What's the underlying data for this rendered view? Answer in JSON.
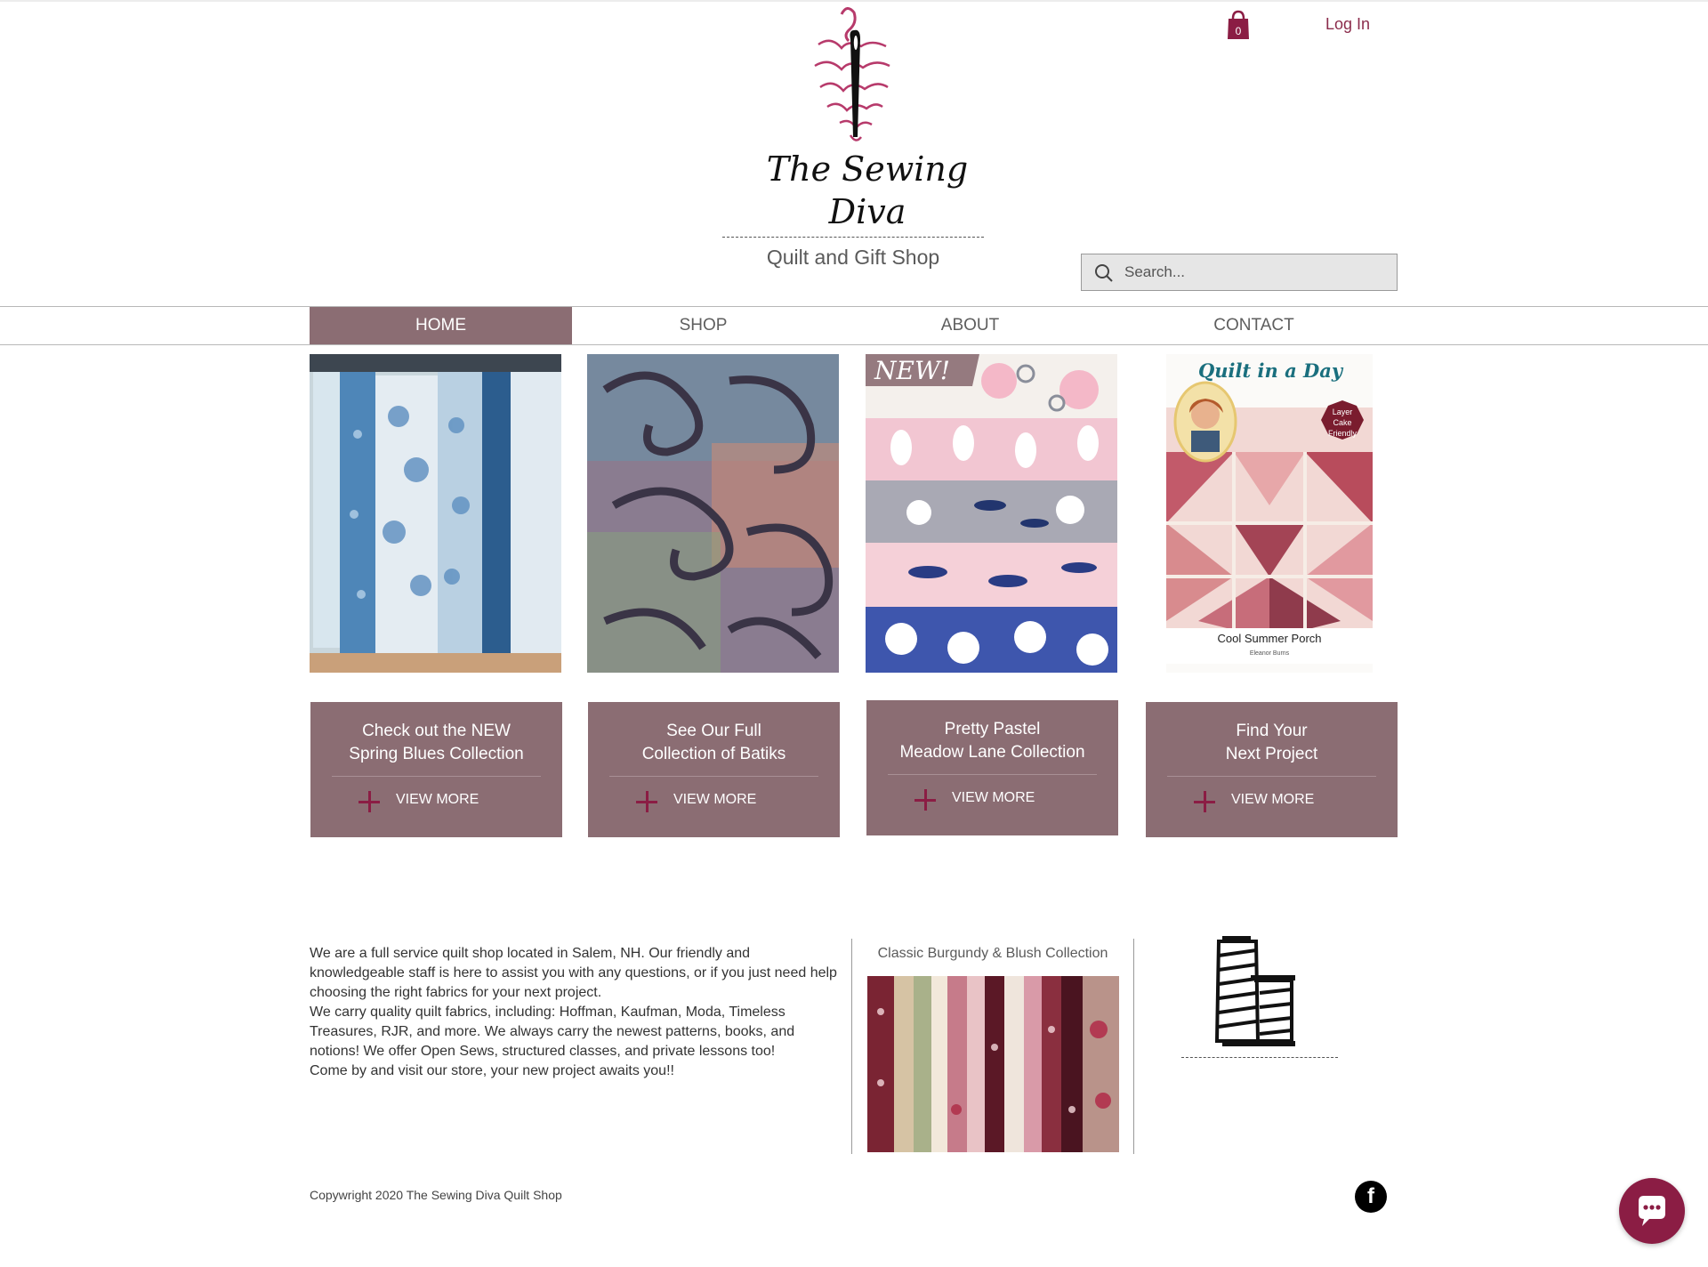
{
  "header": {
    "logo_line1": "The Sewing",
    "logo_line2": "Diva",
    "tagline": "Quilt and Gift Shop",
    "cart_count": "0",
    "login_label": "Log In"
  },
  "search": {
    "placeholder": "Search..."
  },
  "nav": {
    "items": [
      {
        "label": "HOME",
        "active": true
      },
      {
        "label": "SHOP",
        "active": false
      },
      {
        "label": "ABOUT",
        "active": false
      },
      {
        "label": "CONTACT",
        "active": false
      }
    ]
  },
  "products": [
    {
      "title_line1": "Check out the NEW",
      "title_line2": "Spring Blues Collection",
      "cta": "VIEW MORE"
    },
    {
      "title_line1": "See Our Full",
      "title_line2": "Collection of Batiks",
      "cta": "VIEW MORE"
    },
    {
      "title_line1": "Pretty Pastel",
      "title_line2": "Meadow Lane Collection",
      "cta": "VIEW MORE",
      "badge": "NEW!"
    },
    {
      "title_line1": "Find Your",
      "title_line2": "Next Project",
      "cta": "VIEW MORE",
      "book_title": "Quilt in a Day",
      "book_badge": "Layer Cake Friendly",
      "book_subtitle": "Cool Summer Porch",
      "book_author": "Eleanor Burns"
    }
  ],
  "about": {
    "paragraph1": "We are a full service quilt shop located in Salem, NH. Our friendly and knowledgeable staff is here to assist you with any questions, or if you just need help choosing the right fabrics for your next project.",
    "paragraph2": "We carry quality quilt fabrics, including: Hoffman, Kaufman, Moda, Timeless Treasures, RJR, and more. We always carry the newest patterns, books, and notions! We offer Open Sews, structured classes, and private lessons too!",
    "paragraph3": "Come by and visit our store, your new project awaits you!!"
  },
  "featured": {
    "caption": "Classic Burgundy & Blush Collection"
  },
  "footer": {
    "copyright": "Copywright 2020 The Sewing Diva Quilt Shop"
  },
  "colors": {
    "accent": "#8b1d44",
    "card_bg": "#8b6d73",
    "text": "#333333"
  },
  "icons": [
    "needle-logo-icon",
    "cart-icon",
    "search-icon",
    "plus-icon",
    "thread-spool-icon",
    "facebook-icon",
    "chat-icon"
  ]
}
